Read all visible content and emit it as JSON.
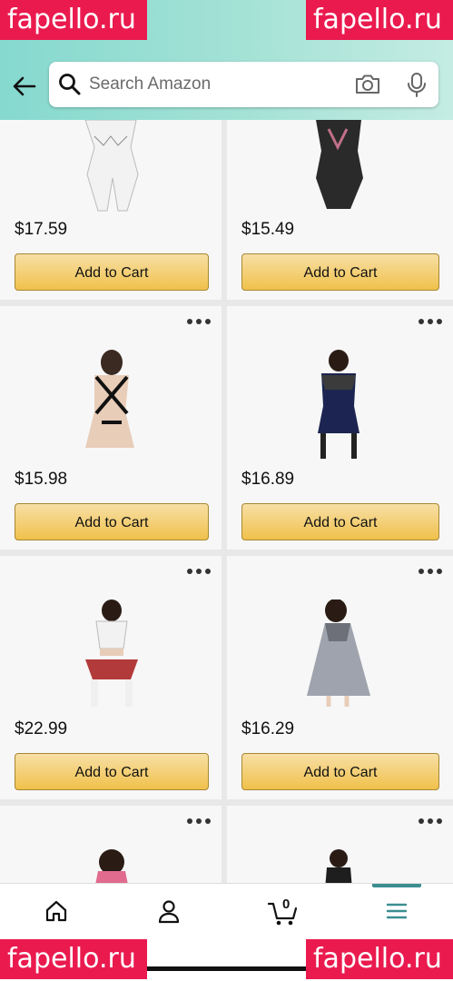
{
  "search": {
    "placeholder": "Search Amazon"
  },
  "products": [
    {
      "price": "$17.59",
      "add_label": "Add to Cart"
    },
    {
      "price": "$15.49",
      "add_label": "Add to Cart"
    },
    {
      "price": "$15.98",
      "add_label": "Add to Cart"
    },
    {
      "price": "$16.89",
      "add_label": "Add to Cart"
    },
    {
      "price": "$22.99",
      "add_label": "Add to Cart"
    },
    {
      "price": "$16.29",
      "add_label": "Add to Cart"
    },
    {
      "price": "",
      "add_label": ""
    },
    {
      "price": "",
      "add_label": ""
    }
  ],
  "nav": {
    "cart_count": "0",
    "active_item": "menu"
  },
  "watermark": "fapello.ru",
  "colors": {
    "header_start": "#85d9cf",
    "button": "#f0c14b",
    "accent": "#3c8e91",
    "watermark": "#ea1a4f"
  },
  "icons": [
    "back-arrow-icon",
    "search-icon",
    "camera-icon",
    "mic-icon",
    "more-options-icon",
    "home-icon",
    "account-icon",
    "cart-icon",
    "menu-icon"
  ]
}
